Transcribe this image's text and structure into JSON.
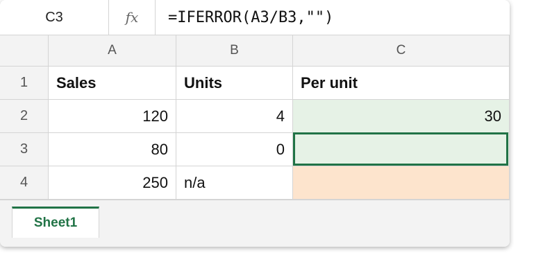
{
  "formula_bar": {
    "name_box": "C3",
    "fx_label": "fx",
    "formula": "=IFERROR(A3/B3,\"\")"
  },
  "columns": [
    "A",
    "B",
    "C"
  ],
  "rows": [
    {
      "row_label": "1",
      "cells": [
        "Sales",
        "Units",
        "Per unit"
      ]
    },
    {
      "row_label": "2",
      "cells": [
        "120",
        "4",
        "30"
      ]
    },
    {
      "row_label": "3",
      "cells": [
        "80",
        "0",
        ""
      ]
    },
    {
      "row_label": "4",
      "cells": [
        "250",
        "n/a",
        ""
      ]
    }
  ],
  "selected_cell": "C3",
  "colors": {
    "accent": "#217346",
    "result_fill": "#e6f2e6",
    "error_fill": "#fde4cd"
  },
  "sheet_tabs": [
    {
      "label": "Sheet1",
      "active": true
    }
  ]
}
